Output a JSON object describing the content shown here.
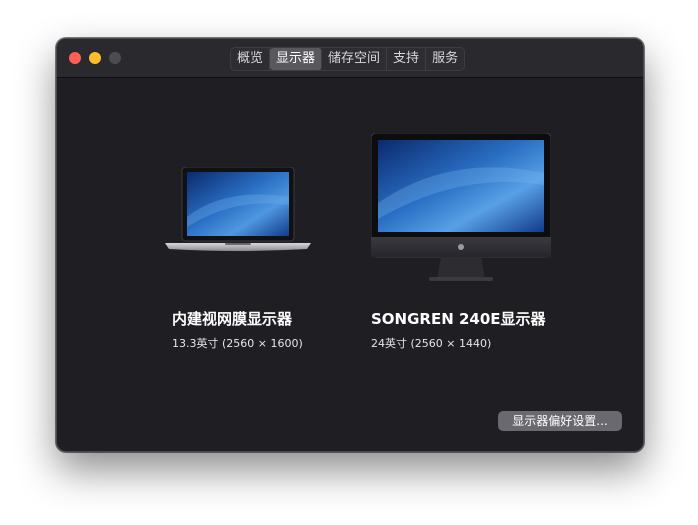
{
  "window": {
    "tabs": [
      {
        "label": "概览"
      },
      {
        "label": "显示器"
      },
      {
        "label": "储存空间"
      },
      {
        "label": "支持"
      },
      {
        "label": "服务"
      }
    ],
    "active_tab": "显示器"
  },
  "displays": [
    {
      "name": "内建视网膜显示器",
      "spec": "13.3英寸 (2560 × 1600)",
      "icon": "laptop-icon"
    },
    {
      "name": "SONGREN 240E显示器",
      "spec": "24英寸 (2560 × 1440)",
      "icon": "imac-icon"
    }
  ],
  "prefs_button": {
    "label": "显示器偏好设置..."
  },
  "colors": {
    "window_bg": "#1f1e22",
    "titlebar_bg": "#2a292e",
    "close": "#fe5f57",
    "minimize": "#febc2e",
    "zoom_inactive": "#4d4c52",
    "button_bg": "#6a696f"
  }
}
